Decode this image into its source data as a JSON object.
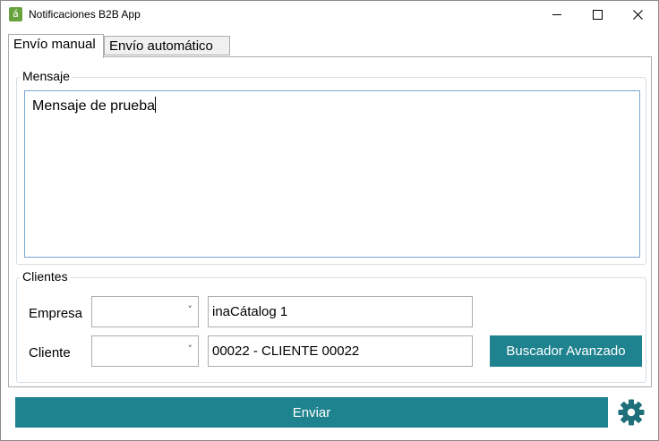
{
  "window": {
    "title": "Notificaciones B2B App",
    "app_icon_glyph": "á",
    "controls": [
      "minimize-icon",
      "maximize-icon",
      "close-icon"
    ]
  },
  "tabs": [
    {
      "label": "Envío manual",
      "active": true
    },
    {
      "label": "Envío automático",
      "active": false
    }
  ],
  "mensaje": {
    "group_label": "Mensaje",
    "text": "Mensaje de prueba"
  },
  "clientes": {
    "group_label": "Clientes",
    "empresa": {
      "label": "Empresa",
      "combo_value": "",
      "text": "inaCátalog 1"
    },
    "cliente": {
      "label": "Cliente",
      "combo_value": "",
      "text": "00022 - CLIENTE 00022"
    },
    "buscador_label": "Buscador Avanzado"
  },
  "enviar_label": "Enviar",
  "colors": {
    "accent": "#1e838f",
    "gear": "#1e6f7a",
    "app_icon": "#68a23f"
  }
}
